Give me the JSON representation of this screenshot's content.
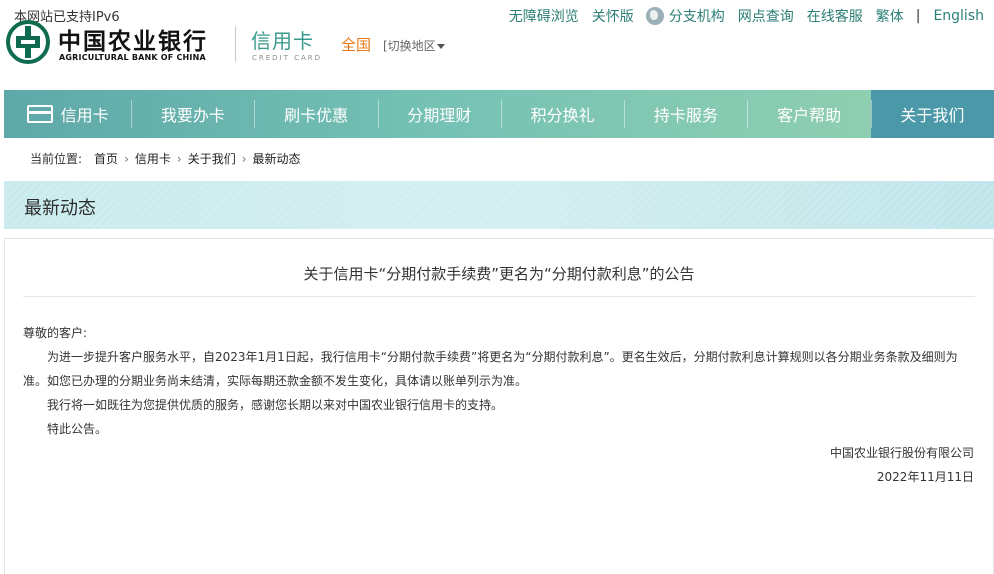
{
  "header": {
    "ipv6_note": "本网站已支持IPv6",
    "logo_cn": "中国农业银行",
    "logo_en": "AGRICULTURAL BANK OF CHINA",
    "credit_card_cn": "信用卡",
    "credit_card_en": "CREDIT CARD",
    "region": "全国",
    "region_switch": "[切换地区",
    "top_links": {
      "accessible": "无障碍浏览",
      "care": "关怀版",
      "branches": "分支机构",
      "outlets": "网点查询",
      "online_service": "在线客服",
      "traditional": "繁体",
      "separator": "|",
      "english": "English"
    }
  },
  "nav": {
    "items": [
      "信用卡",
      "我要办卡",
      "刷卡优惠",
      "分期理财",
      "积分换礼",
      "持卡服务",
      "客户帮助",
      "关于我们"
    ]
  },
  "breadcrumb": {
    "label": "当前位置:",
    "items": [
      "首页",
      "信用卡",
      "关于我们",
      "最新动态"
    ]
  },
  "section": {
    "title": "最新动态"
  },
  "article": {
    "title": "关于信用卡“分期付款手续费”更名为“分期付款利息”的公告",
    "salutation": "尊敬的客户:",
    "paragraphs": [
      "为进一步提升客户服务水平，自2023年1月1日起，我行信用卡“分期付款手续费”将更名为“分期付款利息”。更名生效后，分期付款利息计算规则以各分期业务条款及细则为准。如您已办理的分期业务尚未结清，实际每期还款金额不发生变化，具体请以账单列示为准。",
      "我行将一如既往为您提供优质的服务，感谢您长期以来对中国农业银行信用卡的支持。",
      "特此公告。"
    ],
    "signature": "中国农业银行股份有限公司",
    "date": "2022年11月11日"
  },
  "colors": {
    "brand_green": "#2b7f76",
    "nav_active": "#4b98a8",
    "region_orange": "#e67817"
  }
}
